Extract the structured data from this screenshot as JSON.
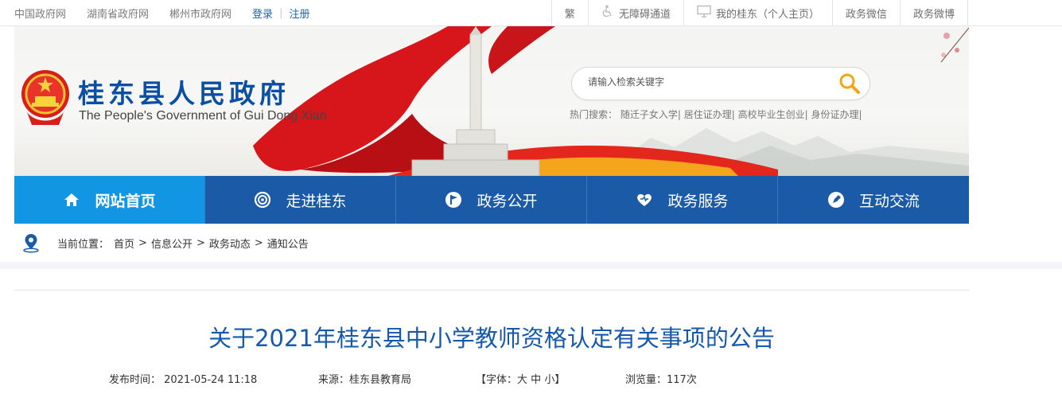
{
  "topbar": {
    "links": [
      "中国政府网",
      "湖南省政府网",
      "郴州市政府网"
    ],
    "login": "登录",
    "separator": "|",
    "register": "注册",
    "right": [
      {
        "label": "繁",
        "icon": ""
      },
      {
        "label": "无障碍通道",
        "icon": "accessibility-icon"
      },
      {
        "label": "我的桂东（个人主页）",
        "icon": "monitor-icon"
      },
      {
        "label": "政务微信",
        "icon": ""
      },
      {
        "label": "政务微博",
        "icon": ""
      }
    ]
  },
  "header": {
    "title": "桂东县人民政府",
    "subtitle": "The People's Government of Gui Dong Xian",
    "search_placeholder": "请输入检索关键字",
    "hot_label": "热门搜索：",
    "hot_items": [
      "随迁子女入学",
      "居住证办理",
      "高校毕业生创业",
      "身份证办理"
    ],
    "hot_sep": "|"
  },
  "nav": [
    {
      "label": "网站首页",
      "icon": "home-icon",
      "active": true
    },
    {
      "label": "走进桂东",
      "icon": "target-icon",
      "active": false
    },
    {
      "label": "政务公开",
      "icon": "flag-icon",
      "active": false
    },
    {
      "label": "政务服务",
      "icon": "heart-icon",
      "active": false
    },
    {
      "label": "互动交流",
      "icon": "chat-icon",
      "active": false
    }
  ],
  "breadcrumb": {
    "label": "当前位置：",
    "items": [
      "首页",
      "信息公开",
      "政务动态",
      "通知公告"
    ],
    "sep": ">"
  },
  "article": {
    "title": "关于2021年桂东县中小学教师资格认定有关事项的公告",
    "publish_label": "发布时间：",
    "publish_time": "2021-05-24 11:18",
    "source_label": "来源：",
    "source": "桂东县教育局",
    "font_open": "【字体：",
    "font_large": "大",
    "font_medium": "中",
    "font_small": "小",
    "font_close": "】",
    "views_label": "浏览量：",
    "views": "117次"
  },
  "colors": {
    "nav": "#1a5aa6",
    "nav_active": "#1296e4",
    "title": "#1559ad",
    "site_title": "#0b4fa3"
  }
}
